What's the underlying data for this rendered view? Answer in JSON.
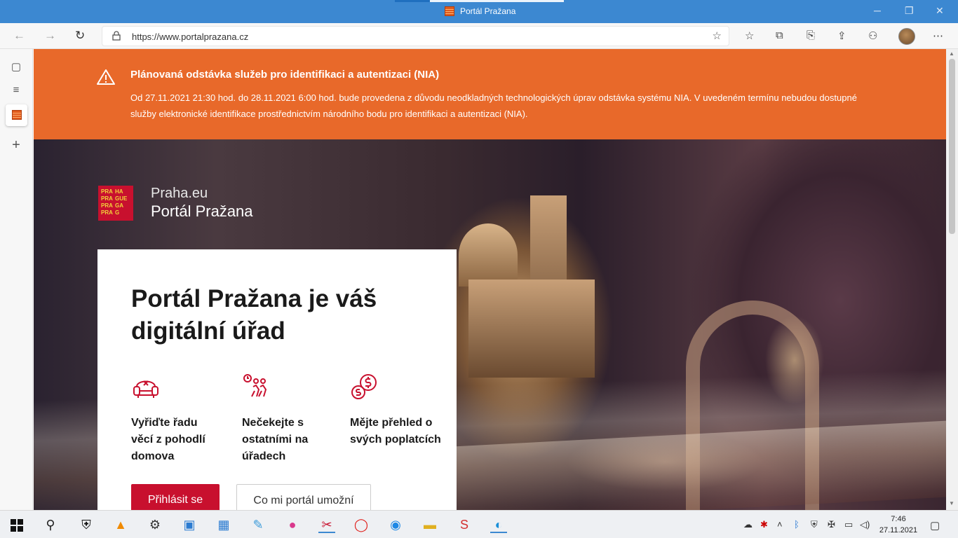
{
  "window": {
    "title": "Portál Pražana"
  },
  "browser": {
    "url": "https://www.portalprazana.cz",
    "icons": [
      "back-icon",
      "forward-icon",
      "reload-icon",
      "lock-icon",
      "add-favorite-icon",
      "favorites-icon",
      "collections-icon",
      "screenshot-icon",
      "share-icon",
      "extensions-icon",
      "avatar",
      "more-icon"
    ]
  },
  "notice": {
    "title": "Plánovaná odstávka služeb pro identifikaci a autentizaci (NIA)",
    "body": "Od 27.11.2021 21:30 hod. do 28.11.2021 6:00 hod. bude provedena z důvodu neodkladných technologických úprav odstávka systému NIA. V uvedeném termínu nebudou dostupné služby elektronické identifikace prostřednictvím národního bodu pro identifikaci a autentizaci (NIA).",
    "color": "#e8692a"
  },
  "logo": {
    "rows": [
      [
        "PRA",
        "HA"
      ],
      [
        "PRA",
        "GUE"
      ],
      [
        "PRA",
        "GA"
      ],
      [
        "PRA",
        "G"
      ]
    ],
    "brand_line1": "Praha.eu",
    "brand_line2": "Portál Pražana"
  },
  "hero": {
    "heading": "Portál Pražana je váš digitální úřad",
    "features": [
      {
        "icon": "armchair-icon",
        "text": "Vyřiďte řadu věcí z pohodlí domova"
      },
      {
        "icon": "no-queue-icon",
        "text": "Nečekejte s ostatními na úřadech"
      },
      {
        "icon": "coins-icon",
        "text": "Mějte přehled o svých poplatcích"
      }
    ],
    "login_label": "Přihlásit se",
    "about_label": "Co mi portál umožní",
    "accent": "#c8102e"
  },
  "taskbar": {
    "time": "7:46",
    "date": "27.11.2021"
  }
}
